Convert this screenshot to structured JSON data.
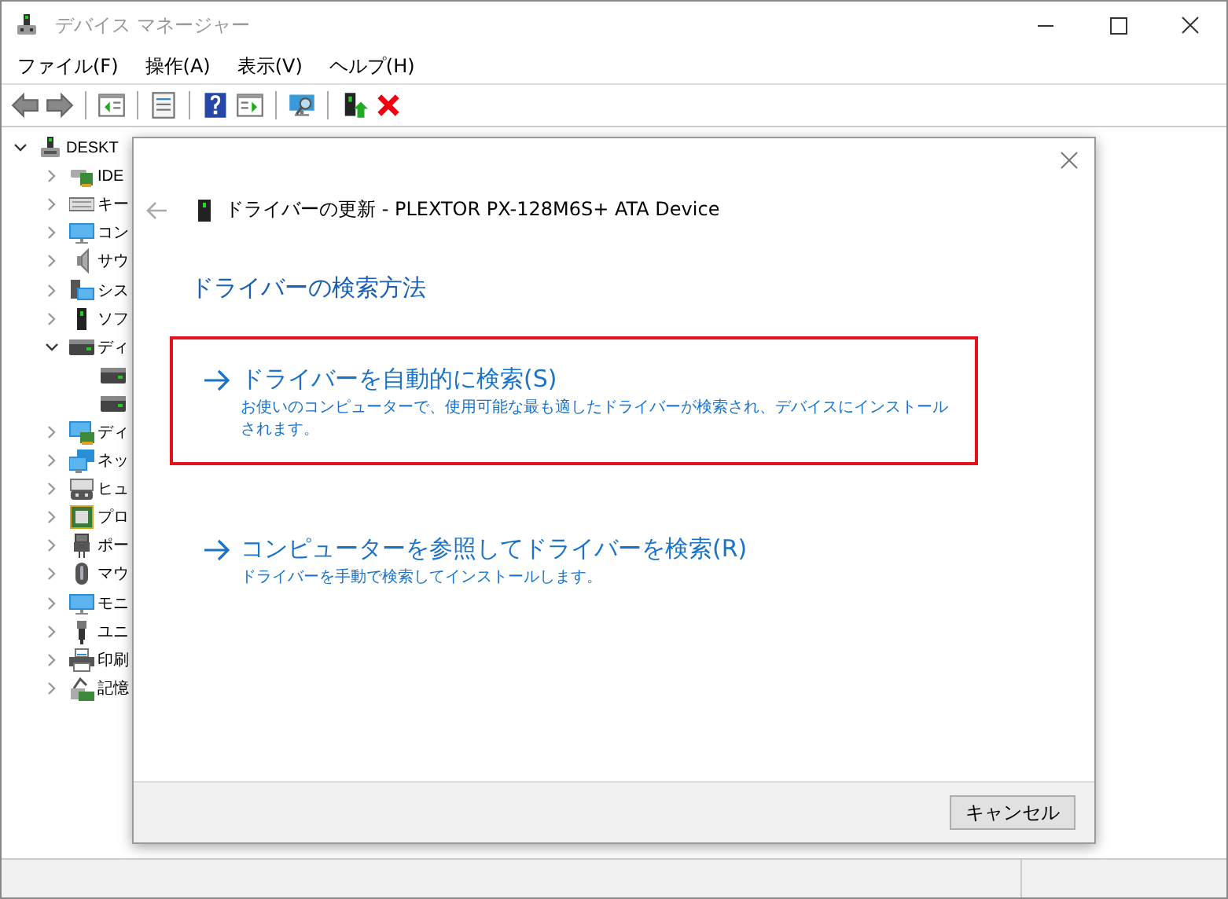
{
  "window": {
    "title": "デバイス マネージャー"
  },
  "menu": [
    "ファイル(F)",
    "操作(A)",
    "表示(V)",
    "ヘルプ(H)"
  ],
  "toolbar": [
    {
      "kind": "back"
    },
    {
      "kind": "forward"
    },
    {
      "kind": "sep"
    },
    {
      "kind": "tree-pane"
    },
    {
      "kind": "sep"
    },
    {
      "kind": "properties"
    },
    {
      "kind": "sep"
    },
    {
      "kind": "help"
    },
    {
      "kind": "action-pane"
    },
    {
      "kind": "sep"
    },
    {
      "kind": "scan"
    },
    {
      "kind": "sep"
    },
    {
      "kind": "update"
    },
    {
      "kind": "remove"
    }
  ],
  "tree": [
    {
      "label": "DESKT",
      "kind": "computer",
      "expanded": true,
      "children": [
        {
          "label": "IDE",
          "kind": "card",
          "expanded": false
        },
        {
          "label": "キー",
          "kind": "keyboard",
          "expanded": false
        },
        {
          "label": "コン",
          "kind": "monitor",
          "expanded": false
        },
        {
          "label": "サウ",
          "kind": "speaker",
          "expanded": false
        },
        {
          "label": "シス",
          "kind": "system",
          "expanded": false
        },
        {
          "label": "ソフ",
          "kind": "tower",
          "expanded": false
        },
        {
          "label": "ディ",
          "kind": "drive",
          "expanded": true,
          "children": [
            {
              "kind": "drive"
            },
            {
              "kind": "drive"
            }
          ]
        },
        {
          "label": "ディ",
          "kind": "display",
          "expanded": false
        },
        {
          "label": "ネッ",
          "kind": "network",
          "expanded": false
        },
        {
          "label": "ヒュ",
          "kind": "hid",
          "expanded": false
        },
        {
          "label": "プロ",
          "kind": "chip",
          "expanded": false
        },
        {
          "label": "ポー",
          "kind": "port",
          "expanded": false
        },
        {
          "label": "マウ",
          "kind": "mouse",
          "expanded": false
        },
        {
          "label": "モニ",
          "kind": "monitor",
          "expanded": false
        },
        {
          "label": "ユニ",
          "kind": "usb",
          "expanded": false
        },
        {
          "label": "印刷",
          "kind": "printer",
          "expanded": false
        },
        {
          "label": "記憶",
          "kind": "storage",
          "expanded": false
        }
      ]
    }
  ],
  "dialog": {
    "title": "ドライバーの更新 - PLEXTOR PX-128M6S+ ATA Device",
    "heading": "ドライバーの検索方法",
    "options": [
      {
        "title": "ドライバーを自動的に検索(S)",
        "description": "お使いのコンピューターで、使用可能な最も適したドライバーが検索され、デバイスにインストールされます。",
        "highlighted": true
      },
      {
        "title": "コンピューターを参照してドライバーを検索(R)",
        "description": "ドライバーを手動で検索してインストールします。",
        "highlighted": false
      }
    ],
    "buttons": [
      "キャンセル"
    ]
  }
}
